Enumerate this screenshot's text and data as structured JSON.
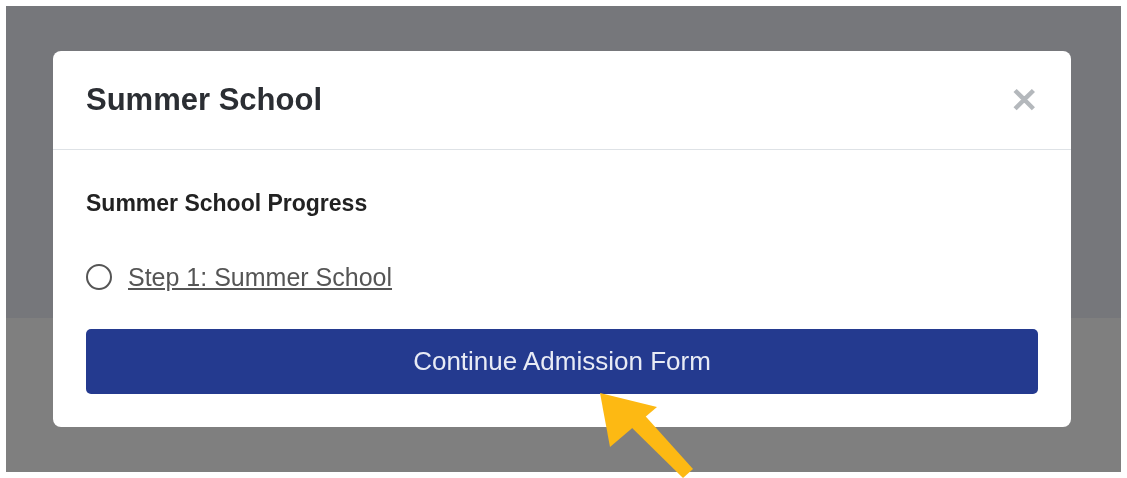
{
  "modal": {
    "title": "Summer School",
    "close": "✕",
    "section_title": "Summer School Progress",
    "steps": [
      {
        "label": "Step 1: Summer School",
        "checked": false
      }
    ],
    "button": "Continue Admission Form"
  }
}
